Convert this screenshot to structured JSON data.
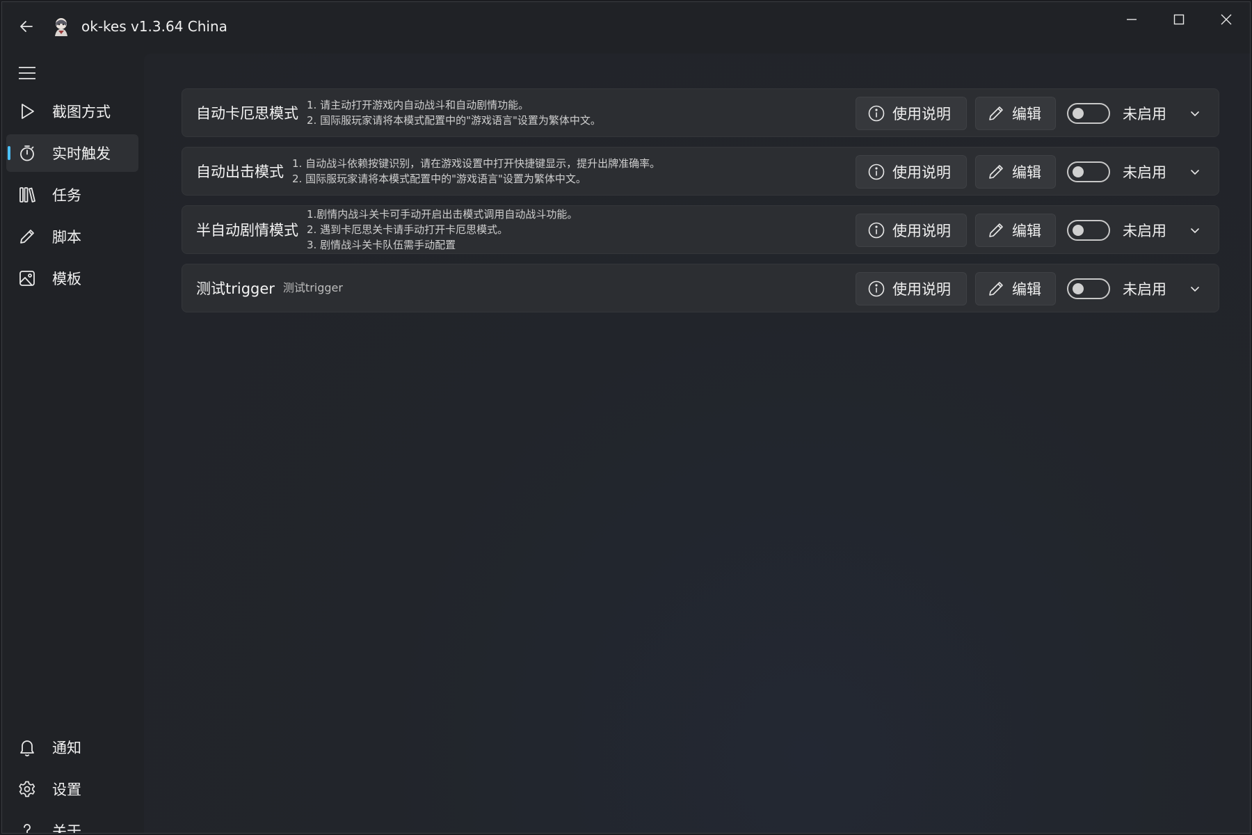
{
  "window": {
    "title": "ok-kes v1.3.64 China"
  },
  "sidebar": {
    "items": [
      {
        "label": "截图方式",
        "icon": "play-icon"
      },
      {
        "label": "实时触发",
        "icon": "stopwatch-icon",
        "active": true
      },
      {
        "label": "任务",
        "icon": "library-icon"
      },
      {
        "label": "脚本",
        "icon": "pencil-icon"
      },
      {
        "label": "模板",
        "icon": "image-icon"
      }
    ],
    "bottom_items": [
      {
        "label": "通知",
        "icon": "bell-icon"
      },
      {
        "label": "设置",
        "icon": "gear-icon"
      },
      {
        "label": "关于",
        "icon": "question-icon"
      }
    ]
  },
  "cards": [
    {
      "title": "自动卡厄思模式",
      "desc": [
        "1. 请主动打开游戏内自动战斗和自动剧情功能。",
        "2. 国际服玩家请将本模式配置中的\"游戏语言\"设置为繁体中文。"
      ],
      "info_label": "使用说明",
      "edit_label": "编辑",
      "status": "未启用"
    },
    {
      "title": "自动出击模式",
      "desc": [
        "1. 自动战斗依赖按键识别，请在游戏设置中打开快捷键显示，提升出牌准确率。",
        "2. 国际服玩家请将本模式配置中的\"游戏语言\"设置为繁体中文。"
      ],
      "info_label": "使用说明",
      "edit_label": "编辑",
      "status": "未启用"
    },
    {
      "title": "半自动剧情模式",
      "desc": [
        "1.剧情内战斗关卡可手动开启出击模式调用自动战斗功能。",
        "2. 遇到卡厄思关卡请手动打开卡厄思模式。",
        "3. 剧情战斗关卡队伍需手动配置"
      ],
      "info_label": "使用说明",
      "edit_label": "编辑",
      "status": "未启用"
    },
    {
      "title": "测试trigger",
      "desc": [
        "测试trigger"
      ],
      "info_label": "使用说明",
      "edit_label": "编辑",
      "status": "未启用"
    }
  ],
  "colors": {
    "accent": "#4cc2ff",
    "background": "#202226",
    "card": "#2c2e32"
  }
}
